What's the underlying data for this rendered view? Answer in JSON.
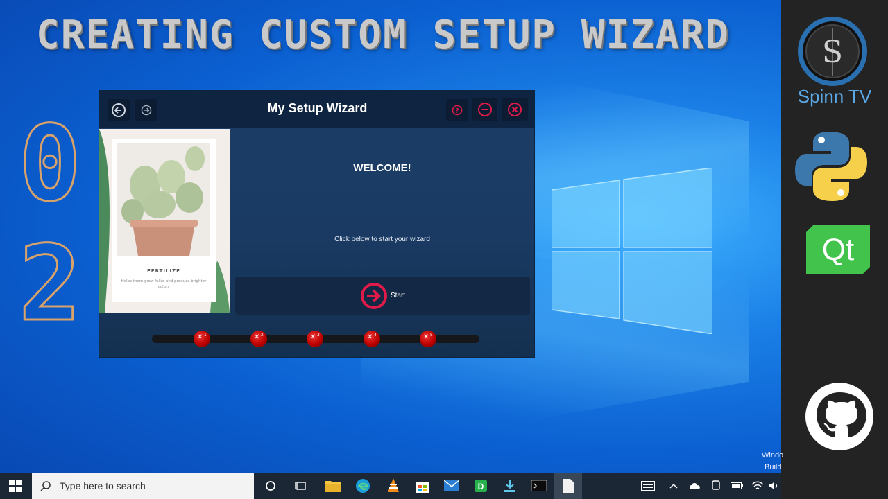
{
  "thumbnail": {
    "title": "CREATING CUSTOM SETUP WIZARD",
    "episode_digits": [
      "0",
      "2"
    ]
  },
  "sidebar": {
    "channel_name": "Spinn TV",
    "logos": [
      "spinn-tv-logo",
      "python-logo",
      "qt-logo",
      "github-logo"
    ],
    "qt_text": "Qt"
  },
  "wizard": {
    "title": "My Setup Wizard",
    "welcome": "WELCOME!",
    "subtext": "Click below to start your wizard",
    "start_label": "Start",
    "card": {
      "title": "FERTILIZE",
      "text": "Helps them grow fuller and produce brighter colors"
    },
    "steps": [
      "1",
      "2",
      "3",
      "4",
      "5"
    ],
    "accent_color": "#e01b4a"
  },
  "taskbar": {
    "search_placeholder": "Type here to search",
    "apps": [
      "task-view",
      "task-switcher",
      "file-explorer",
      "edge",
      "vlc",
      "store",
      "mail",
      "app-d",
      "installer",
      "terminal",
      "notepad"
    ],
    "app_d_letter": "D",
    "watermark": [
      "Windo",
      "Build"
    ]
  }
}
